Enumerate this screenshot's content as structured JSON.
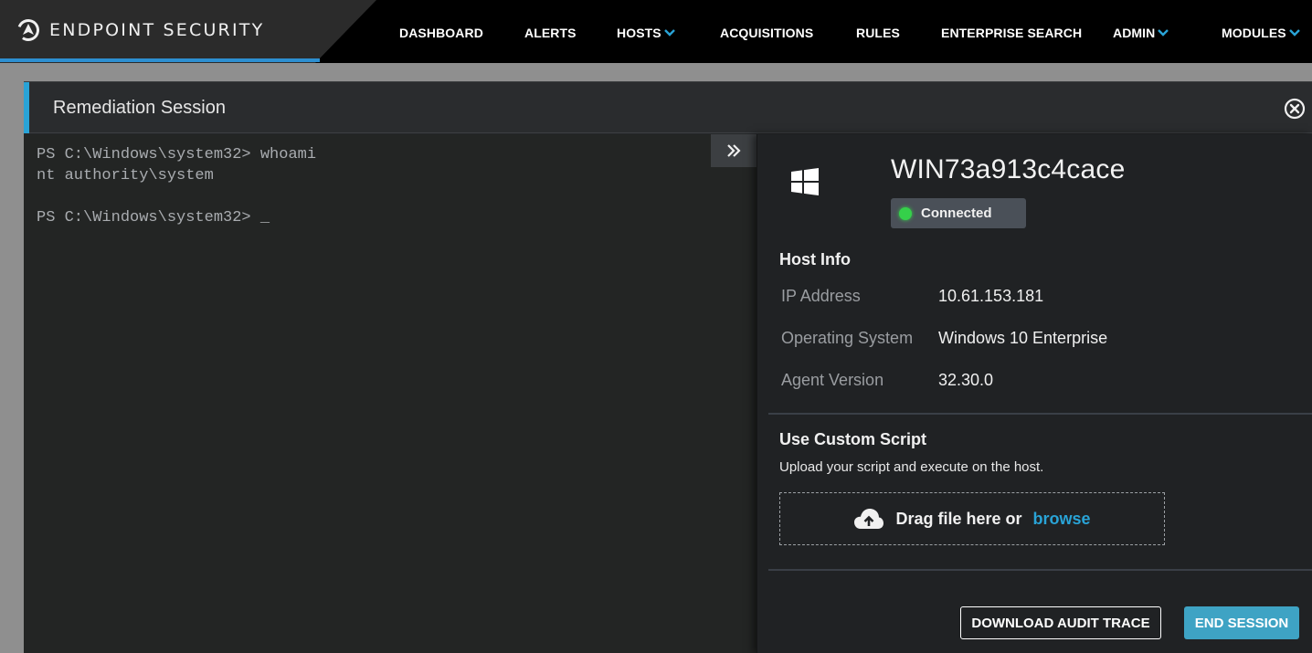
{
  "brand": {
    "name": "ENDPOINT SECURITY",
    "logo_icon": "endpoint-logo-icon"
  },
  "nav": {
    "items": [
      {
        "label": "DASHBOARD",
        "has_dropdown": false
      },
      {
        "label": "ALERTS",
        "has_dropdown": false
      },
      {
        "label": "HOSTS",
        "has_dropdown": true
      },
      {
        "label": "ACQUISITIONS",
        "has_dropdown": false
      },
      {
        "label": "RULES",
        "has_dropdown": false
      },
      {
        "label": "ENTERPRISE SEARCH",
        "has_dropdown": false
      },
      {
        "label": "ADMIN",
        "has_dropdown": true
      },
      {
        "label": "MODULES",
        "has_dropdown": true
      }
    ],
    "chevron_color": "#29a3d6"
  },
  "session": {
    "title": "Remediation Session",
    "close_icon": "close-circle-icon"
  },
  "terminal": {
    "lines": [
      "PS C:\\Windows\\system32> whoami",
      "nt authority\\system",
      "",
      "PS C:\\Windows\\system32> _"
    ],
    "collapse_icon": "double-chevron-right-icon"
  },
  "host": {
    "os_icon": "windows-icon",
    "name": "WIN73a913c4cace",
    "status": "Connected",
    "status_color": "#35d04a",
    "info_title": "Host Info",
    "info": [
      {
        "label": "IP Address",
        "value": "10.61.153.181"
      },
      {
        "label": "Operating System",
        "value": "Windows 10 Enterprise"
      },
      {
        "label": "Agent Version",
        "value": "32.30.0"
      }
    ]
  },
  "script": {
    "title": "Use Custom Script",
    "description": "Upload your script and execute on the host.",
    "drop_text": "Drag file here or",
    "browse_link": "browse",
    "upload_icon": "cloud-upload-icon"
  },
  "actions": {
    "download_label": "DOWNLOAD AUDIT TRACE",
    "end_label": "END SESSION"
  },
  "colors": {
    "accent": "#29a3d6",
    "primary_button": "#3ea3c4",
    "panel_bg": "#242628"
  }
}
